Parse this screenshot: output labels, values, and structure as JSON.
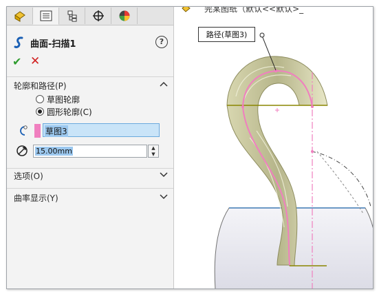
{
  "tabs": [
    {
      "name": "feature-manager-tab-icon"
    },
    {
      "name": "property-manager-tab-icon",
      "active": true
    },
    {
      "name": "configuration-manager-tab-icon"
    },
    {
      "name": "dimxpert-tab-icon"
    },
    {
      "name": "display-manager-tab-icon"
    }
  ],
  "header": {
    "title": "曲面-扫描1",
    "help": "?"
  },
  "actions": {
    "ok": "✔",
    "cancel": "✕"
  },
  "sections": {
    "profile_path": {
      "label": "轮廓和路径(P)",
      "options": [
        {
          "label": "草图轮廓",
          "selected": false
        },
        {
          "label": "圆形轮廓(C)",
          "selected": true
        }
      ],
      "path_value": "草图3",
      "diameter_value": "15.00mm"
    },
    "options": {
      "label": "选项(O)"
    },
    "curvature": {
      "label": "曲率显示(Y)"
    }
  },
  "graphics": {
    "breadcrumb": "完某图纸（默认<<默认>_",
    "callout": "路径(草图3)"
  },
  "colors": {
    "path_highlight": "#f07fbf",
    "ok": "#2f9c2f",
    "cancel": "#d12020",
    "surface": "#c8c79a"
  }
}
